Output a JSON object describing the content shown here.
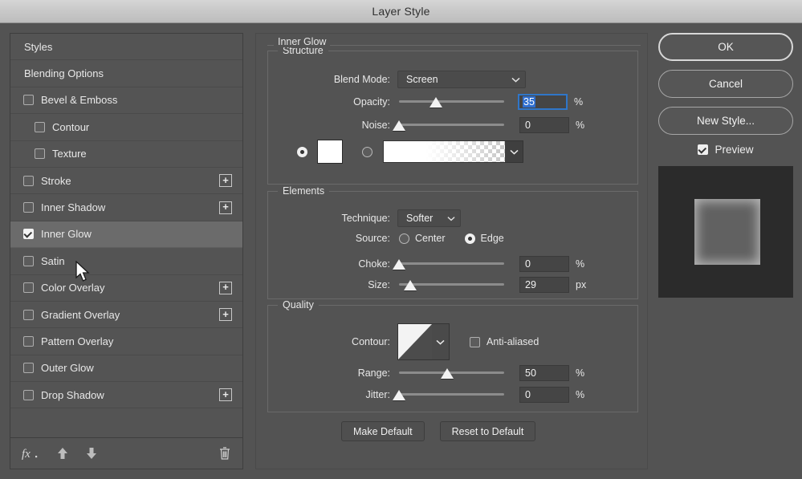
{
  "window": {
    "title": "Layer Style"
  },
  "sidebar": {
    "items": [
      {
        "label": "Styles",
        "type": "header",
        "checkbox": false,
        "checked": false,
        "plus": false,
        "selected": false,
        "sub": false
      },
      {
        "label": "Blending Options",
        "type": "header",
        "checkbox": false,
        "checked": false,
        "plus": false,
        "selected": false,
        "sub": false
      },
      {
        "label": "Bevel & Emboss",
        "type": "effect",
        "checkbox": true,
        "checked": false,
        "plus": false,
        "selected": false,
        "sub": false
      },
      {
        "label": "Contour",
        "type": "effect",
        "checkbox": true,
        "checked": false,
        "plus": false,
        "selected": false,
        "sub": true
      },
      {
        "label": "Texture",
        "type": "effect",
        "checkbox": true,
        "checked": false,
        "plus": false,
        "selected": false,
        "sub": true
      },
      {
        "label": "Stroke",
        "type": "effect",
        "checkbox": true,
        "checked": false,
        "plus": true,
        "selected": false,
        "sub": false
      },
      {
        "label": "Inner Shadow",
        "type": "effect",
        "checkbox": true,
        "checked": false,
        "plus": true,
        "selected": false,
        "sub": false
      },
      {
        "label": "Inner Glow",
        "type": "effect",
        "checkbox": true,
        "checked": true,
        "plus": false,
        "selected": true,
        "sub": false
      },
      {
        "label": "Satin",
        "type": "effect",
        "checkbox": true,
        "checked": false,
        "plus": false,
        "selected": false,
        "sub": false
      },
      {
        "label": "Color Overlay",
        "type": "effect",
        "checkbox": true,
        "checked": false,
        "plus": true,
        "selected": false,
        "sub": false
      },
      {
        "label": "Gradient Overlay",
        "type": "effect",
        "checkbox": true,
        "checked": false,
        "plus": true,
        "selected": false,
        "sub": false
      },
      {
        "label": "Pattern Overlay",
        "type": "effect",
        "checkbox": true,
        "checked": false,
        "plus": false,
        "selected": false,
        "sub": false
      },
      {
        "label": "Outer Glow",
        "type": "effect",
        "checkbox": true,
        "checked": false,
        "plus": false,
        "selected": false,
        "sub": false
      },
      {
        "label": "Drop Shadow",
        "type": "effect",
        "checkbox": true,
        "checked": false,
        "plus": true,
        "selected": false,
        "sub": false
      }
    ],
    "toolbar": {
      "fx_icon": "fx-icon",
      "move_up_icon": "arrow-up-icon",
      "move_down_icon": "arrow-down-icon",
      "delete_icon": "trash-icon"
    }
  },
  "main": {
    "effect_title": "Inner Glow",
    "structure": {
      "legend": "Structure",
      "blend_mode": {
        "label": "Blend Mode:",
        "value": "Screen"
      },
      "opacity": {
        "label": "Opacity:",
        "value": "35",
        "unit": "%",
        "slider_pct": 35,
        "focused": true
      },
      "noise": {
        "label": "Noise:",
        "value": "0",
        "unit": "%",
        "slider_pct": 0,
        "focused": false
      },
      "fill_type": {
        "color_selected": true,
        "color_value": "#ffffff",
        "gradient_selected": false,
        "gradient_from": "#ffffff",
        "gradient_to": "transparent"
      }
    },
    "elements": {
      "legend": "Elements",
      "technique": {
        "label": "Technique:",
        "value": "Softer"
      },
      "source": {
        "label": "Source:",
        "options": [
          "Center",
          "Edge"
        ],
        "selected": "Edge"
      },
      "choke": {
        "label": "Choke:",
        "value": "0",
        "unit": "%",
        "slider_pct": 0
      },
      "size": {
        "label": "Size:",
        "value": "29",
        "unit": "px",
        "slider_pct": 11
      }
    },
    "quality": {
      "legend": "Quality",
      "contour": {
        "label": "Contour:",
        "shape": "linear"
      },
      "anti_aliased": {
        "label": "Anti-aliased",
        "checked": false
      },
      "range": {
        "label": "Range:",
        "value": "50",
        "unit": "%",
        "slider_pct": 46
      },
      "jitter": {
        "label": "Jitter:",
        "value": "0",
        "unit": "%",
        "slider_pct": 0
      }
    },
    "buttons": {
      "make_default": "Make Default",
      "reset_to_default": "Reset to Default"
    }
  },
  "right": {
    "ok": "OK",
    "cancel": "Cancel",
    "new_style": "New Style...",
    "preview": {
      "label": "Preview",
      "checked": true
    }
  },
  "colors": {
    "dialog_bg": "#535353",
    "titlebar": "#c8c8c8",
    "selected_row": "#6b6b6b",
    "focus_blue": "#2f6fd0",
    "text": "#e8e8e8",
    "preview_canvas": "#2b2b2b",
    "preview_shape": "#616161"
  }
}
